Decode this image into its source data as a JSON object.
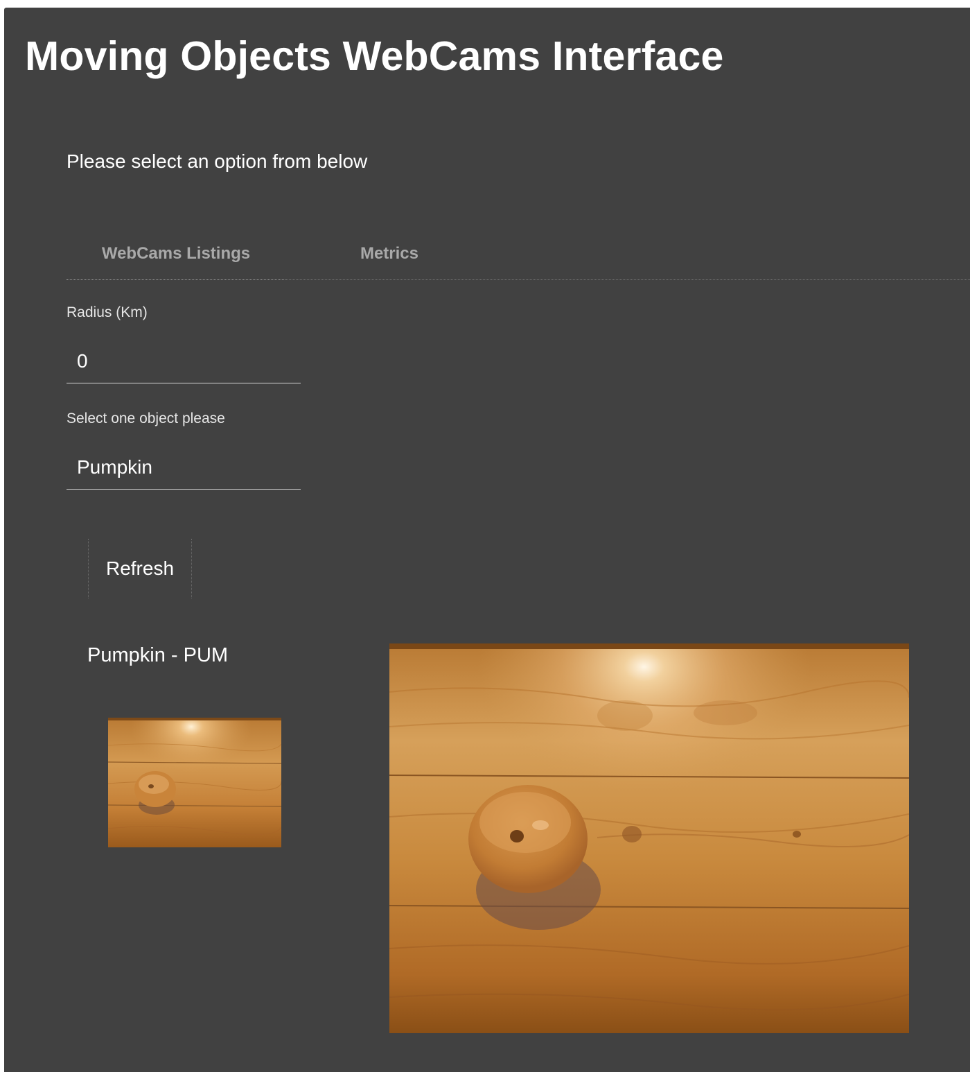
{
  "app": {
    "title": "Moving Objects WebCams Interface",
    "subtitle": "Please select an option from below"
  },
  "tabs": [
    {
      "label": "WebCams Listings",
      "selected": true
    },
    {
      "label": "Metrics",
      "selected": false
    }
  ],
  "form": {
    "radius": {
      "label": "Radius (Km)",
      "value": "0"
    },
    "object": {
      "label": "Select one object please",
      "value": "Pumpkin"
    }
  },
  "actions": {
    "refresh_label": "Refresh"
  },
  "results": {
    "caption": "Pumpkin - PUM"
  },
  "colors": {
    "background": "#414141",
    "text": "#ffffff",
    "tab_text": "#a9a9a9",
    "wood": "#c98a3e",
    "wood_dark": "#8a4f16"
  },
  "icons": {
    "thumbnail": "webcam-thumbnail-image",
    "main_view": "webcam-main-image"
  }
}
